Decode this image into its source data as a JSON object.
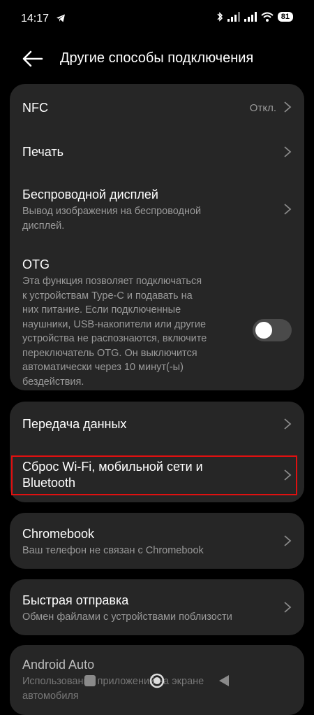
{
  "status_bar": {
    "time": "14:17",
    "battery": "81",
    "icons": [
      "telegram-icon",
      "bluetooth-icon",
      "signal-icon",
      "signal-icon",
      "wifi-icon",
      "battery-icon"
    ]
  },
  "header": {
    "title": "Другие способы подключения",
    "back_icon": "arrow-left-icon"
  },
  "groups": [
    {
      "items": [
        {
          "title": "NFC",
          "value": "Откл."
        },
        {
          "title": "Печать"
        },
        {
          "title": "Беспроводной дисплей",
          "subtitle_lines": [
            "Вывод изображения на беспроводной",
            "дисплей."
          ]
        },
        {
          "title": "OTG",
          "subtitle_lines": [
            "Эта функция позволяет подключаться",
            "к устройствам Type-C и подавать на",
            "них питание. Если подключенные",
            "наушники, USB-накопители или другие",
            "устройства не распознаются, включите",
            "переключатель OTG. Он выключится",
            "автоматически через 10 минут(-ы)",
            "бездействия."
          ],
          "toggle_on": false
        }
      ]
    },
    {
      "items": [
        {
          "title": "Передача данных"
        },
        {
          "title_lines": [
            "Сброс Wi-Fi, мобильной сети и",
            "Bluetooth"
          ]
        }
      ]
    },
    {
      "items": [
        {
          "title": "Chromebook",
          "subtitle": "Ваш телефон не связан с Chromebook"
        }
      ]
    },
    {
      "items": [
        {
          "title": "Быстрая отправка",
          "subtitle": "Обмен файлами с устройствами поблизости"
        }
      ]
    },
    {
      "items": [
        {
          "title": "Android Auto",
          "subtitle_lines": [
            "Использование приложений на экране",
            "автомобиля"
          ]
        }
      ]
    }
  ],
  "colors": {
    "background": "#000000",
    "card": "#262626",
    "secondary_text": "#9a9a9a",
    "highlight": "#e01010"
  }
}
